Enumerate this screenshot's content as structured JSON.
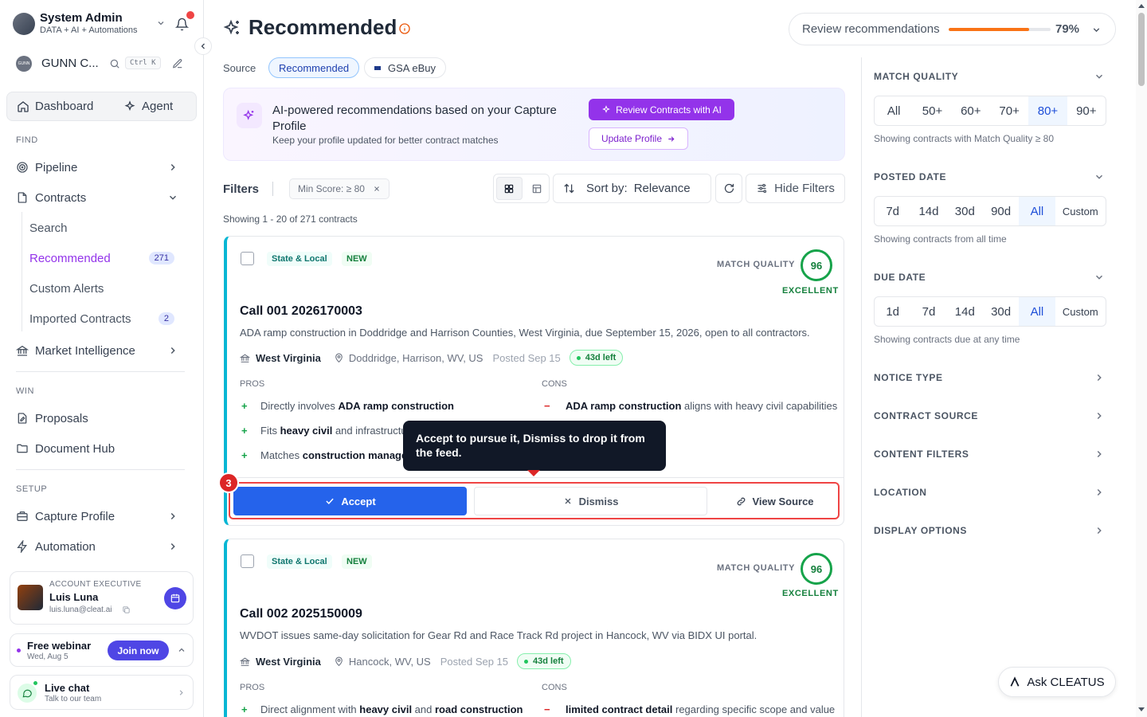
{
  "user": {
    "name": "System Admin",
    "subtitle": "DATA + AI + Automations"
  },
  "workspace": {
    "name": "GUNN C...",
    "logo": "GUNN",
    "shortcut": "Ctrl K"
  },
  "topnav": {
    "dashboard": "Dashboard",
    "agent": "Agent"
  },
  "sections": {
    "find": "FIND",
    "win": "WIN",
    "setup": "SETUP"
  },
  "nav": {
    "pipeline": "Pipeline",
    "contracts": "Contracts",
    "search": "Search",
    "recommended": "Recommended",
    "recommended_count": "271",
    "custom_alerts": "Custom Alerts",
    "imported": "Imported Contracts",
    "imported_count": "2",
    "market": "Market Intelligence",
    "proposals": "Proposals",
    "document_hub": "Document Hub",
    "capture_profile": "Capture Profile",
    "automation": "Automation"
  },
  "account_exec": {
    "role": "ACCOUNT EXECUTIVE",
    "name": "Luis Luna",
    "email": "luis.luna@cleat.ai"
  },
  "webinar": {
    "title": "Free webinar",
    "date": "Wed, Aug 5",
    "cta": "Join now"
  },
  "livechat": {
    "title": "Live chat",
    "subtitle": "Talk to our team"
  },
  "page": {
    "title": "Recommended"
  },
  "review": {
    "label": "Review recommendations",
    "percent": "79%",
    "progress": 0.79
  },
  "source": {
    "label": "Source",
    "recommended": "Recommended",
    "gsa": "GSA eBuy"
  },
  "banner": {
    "title": "AI-powered recommendations based on your Capture Profile",
    "subtitle": "Keep your profile updated for better contract matches",
    "review_btn": "Review Contracts with AI",
    "update_btn": "Update Profile"
  },
  "filters": {
    "label": "Filters",
    "min_score": "Min Score: ≥ 80",
    "sort_label": "Sort by:",
    "sort_value": "Relevance",
    "hide": "Hide Filters"
  },
  "showing": "Showing 1 - 20 of 271 contracts",
  "cards": [
    {
      "tag1": "State & Local",
      "tag2": "NEW",
      "mq_label": "MATCH QUALITY",
      "score": "96",
      "grade": "EXCELLENT",
      "title": "Call 001 2026170003",
      "desc": "ADA ramp construction in Doddridge and Harrison Counties, West Virginia, due September 15, 2026, open to all contractors.",
      "agency": "West Virginia",
      "location": "Doddridge, Harrison, WV, US",
      "posted": "Posted Sep 15",
      "left": "43d left",
      "pros_label": "PROS",
      "cons_label": "CONS",
      "pro1_a": "Directly involves ",
      "pro1_b": "ADA ramp construction",
      "pro2_a": "Fits ",
      "pro2_b": "heavy civil",
      "pro2_c": " and infrastructu",
      "pro3_a": "Matches ",
      "pro3_b": "construction manager",
      "con1_b": "ADA ramp construction",
      "con1_c": " aligns with heavy civil capabilities",
      "accept": "Accept",
      "dismiss": "Dismiss",
      "view": "View Source"
    },
    {
      "tag1": "State & Local",
      "tag2": "NEW",
      "mq_label": "MATCH QUALITY",
      "score": "96",
      "grade": "EXCELLENT",
      "title": "Call 002 2025150009",
      "desc": "WVDOT issues same-day solicitation for Gear Rd and Race Track Rd project in Hancock, WV via BIDX UI portal.",
      "agency": "West Virginia",
      "location": "Hancock, WV, US",
      "posted": "Posted Sep 15",
      "left": "43d left",
      "pros_label": "PROS",
      "cons_label": "CONS",
      "pro1_a": "Direct alignment with ",
      "pro1_b": "heavy civil",
      "pro1_c": " and ",
      "pro1_d": "road construction",
      "con1_b": "limited contract detail",
      "con1_c": " regarding specific scope and value"
    }
  ],
  "tooltip": {
    "text": "Accept to pursue it, Dismiss to drop it from the feed.",
    "step": "3"
  },
  "right": {
    "match_quality": "MATCH QUALITY",
    "mq_opts": [
      "All",
      "50+",
      "60+",
      "70+",
      "80+",
      "90+"
    ],
    "mq_note": "Showing contracts with Match Quality ≥ 80",
    "posted": "POSTED DATE",
    "posted_opts": [
      "7d",
      "14d",
      "30d",
      "90d",
      "All",
      "Custom"
    ],
    "posted_note": "Showing contracts from all time",
    "due": "DUE DATE",
    "due_opts": [
      "1d",
      "7d",
      "14d",
      "30d",
      "All",
      "Custom"
    ],
    "due_note": "Showing contracts due at any time",
    "notice": "NOTICE TYPE",
    "csource": "CONTRACT SOURCE",
    "content": "CONTENT FILTERS",
    "location": "LOCATION",
    "display": "DISPLAY OPTIONS"
  },
  "ask": "Ask CLEATUS",
  "colors": {
    "accent": "#2563eb",
    "purple": "#9333ea",
    "teal": "#06b6d4",
    "green": "#16a34a",
    "red": "#dc2626"
  }
}
